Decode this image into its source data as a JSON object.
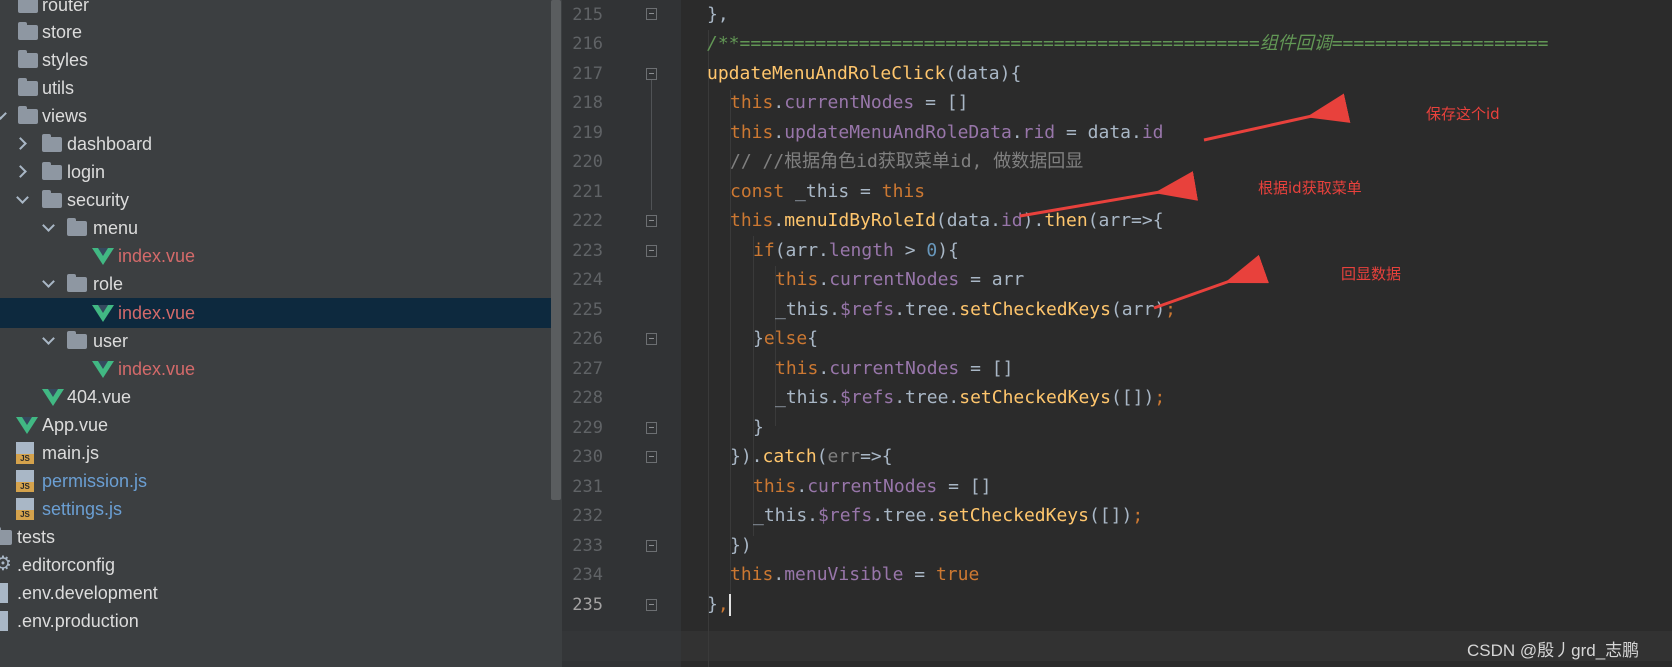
{
  "project_tree": {
    "items": [
      {
        "label": "router",
        "type": "folder"
      },
      {
        "label": "store",
        "type": "folder"
      },
      {
        "label": "styles",
        "type": "folder"
      },
      {
        "label": "utils",
        "type": "folder"
      },
      {
        "label": "views",
        "type": "folder",
        "expanded": true
      },
      {
        "label": "dashboard",
        "type": "folder",
        "expanded": false
      },
      {
        "label": "login",
        "type": "folder",
        "expanded": false
      },
      {
        "label": "security",
        "type": "folder",
        "expanded": true
      },
      {
        "label": "menu",
        "type": "folder",
        "expanded": true
      },
      {
        "label": "index.vue",
        "type": "vue",
        "modified": true
      },
      {
        "label": "role",
        "type": "folder",
        "expanded": true
      },
      {
        "label": "index.vue",
        "type": "vue",
        "modified": true,
        "selected": true
      },
      {
        "label": "user",
        "type": "folder",
        "expanded": true
      },
      {
        "label": "index.vue",
        "type": "vue",
        "modified": true
      },
      {
        "label": "404.vue",
        "type": "vue"
      },
      {
        "label": "App.vue",
        "type": "vue"
      },
      {
        "label": "main.js",
        "type": "js"
      },
      {
        "label": "permission.js",
        "type": "js",
        "changed": true
      },
      {
        "label": "settings.js",
        "type": "js",
        "changed": true
      },
      {
        "label": "tests",
        "type": "folder"
      },
      {
        "label": ".editorconfig",
        "type": "config"
      },
      {
        "label": ".env.development",
        "type": "file"
      },
      {
        "label": ".env.production",
        "type": "file"
      }
    ]
  },
  "editor": {
    "current_line": "235",
    "lines": [
      {
        "n": "215"
      },
      {
        "n": "216"
      },
      {
        "n": "217"
      },
      {
        "n": "218"
      },
      {
        "n": "219"
      },
      {
        "n": "220"
      },
      {
        "n": "221"
      },
      {
        "n": "222"
      },
      {
        "n": "223"
      },
      {
        "n": "224"
      },
      {
        "n": "225"
      },
      {
        "n": "226"
      },
      {
        "n": "227"
      },
      {
        "n": "228"
      },
      {
        "n": "229"
      },
      {
        "n": "230"
      },
      {
        "n": "231"
      },
      {
        "n": "232"
      },
      {
        "n": "233"
      },
      {
        "n": "234"
      },
      {
        "n": "235"
      }
    ],
    "code": {
      "l215": "},",
      "l216_a": "/**================================================",
      "l216_b": "组件回调",
      "l216_c": "====================",
      "l217_fn": "updateMenuAndRoleClick",
      "l217_rest": "(data){",
      "l218_this": "this",
      "l218_prop": "currentNodes",
      "l218_rest": " = []",
      "l219_this": "this",
      "l219_prop": "updateMenuAndRoleData",
      "l219_prop2": "rid",
      "l219_rest": " = data.",
      "l219_prop3": "id",
      "l220": "// //根据角色id获取菜单id, 做数据回显",
      "l221_kw": "const",
      "l221_mid": " _this = ",
      "l221_kw2": "this",
      "l222_this": "this",
      "l222_fn": "menuIdByRoleId",
      "l222_a": "(data.",
      "l222_id": "id",
      "l222_b": ").",
      "l222_then": "then",
      "l222_c": "(arr=>{",
      "l223_kw": "if",
      "l223_a": "(arr.",
      "l223_len": "length",
      "l223_b": " > ",
      "l223_num": "0",
      "l223_c": "){",
      "l224_this": "this",
      "l224_prop": "currentNodes",
      "l224_rest": " = arr",
      "l225_a": "_this.",
      "l225_refs": "$refs",
      "l225_b": ".tree.",
      "l225_fn": "setCheckedKeys",
      "l225_c": "(arr)",
      "l226_a": "}",
      "l226_kw": "else",
      "l226_b": "{",
      "l227_this": "this",
      "l227_prop": "currentNodes",
      "l227_rest": " = []",
      "l228_a": "_this.",
      "l228_refs": "$refs",
      "l228_b": ".tree.",
      "l228_fn": "setCheckedKeys",
      "l228_c": "([])",
      "l229": "}",
      "l230_a": "}).",
      "l230_fn": "catch",
      "l230_err": "err",
      "l230_b": "=>{",
      "l231_this": "this",
      "l231_prop": "currentNodes",
      "l231_rest": " = []",
      "l232_a": "_this.",
      "l232_refs": "$refs",
      "l232_b": ".tree.",
      "l232_fn": "setCheckedKeys",
      "l232_c": "([])",
      "l233": "})",
      "l234_this": "this",
      "l234_prop": "menuVisible",
      "l234_rest": " = ",
      "l234_kw": "true",
      "l235": "},",
      "semi": ";",
      "comma": ",",
      "dot": "."
    }
  },
  "annotations": {
    "save_id": "保存这个id",
    "get_menu": "根据id获取菜单",
    "echo_data": "回显数据"
  },
  "watermark": "CSDN @殷丿grd_志鹏",
  "colors": {
    "annotation": "#e8413c",
    "keyword": "#cc7832",
    "property": "#9876aa",
    "function": "#ffc66d",
    "number": "#6897bb",
    "comment": "#808080",
    "doc_comment": "#629755",
    "selection": "#0d293e"
  }
}
